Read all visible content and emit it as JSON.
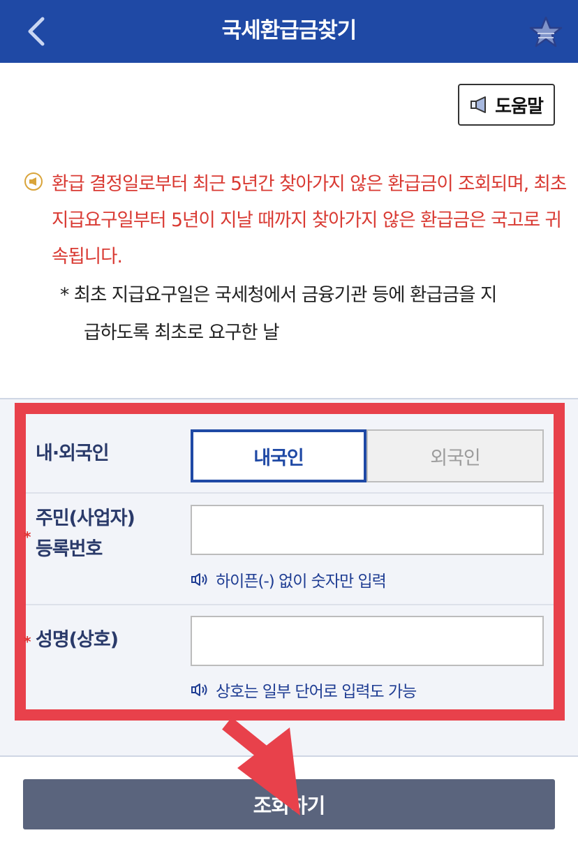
{
  "header": {
    "title": "국세환급금찾기"
  },
  "help": {
    "label": "도움말"
  },
  "notice": {
    "text": "환급 결정일로부터 최근 5년간 찾아가지 않은 환급금이 조회되며, 최초 지급요구일부터 5년이 지날 때까지 찾아가지 않은 환급금은 국고로 귀속됩니다.",
    "footnote_line1": "* 최초 지급요구일은 국세청에서 금융기관 등에 환급금을 지",
    "footnote_line2": "급하도록 최초로 요구한 날"
  },
  "form": {
    "nationality": {
      "label": "내·외국인",
      "options": [
        "내국인",
        "외국인"
      ],
      "selected": "내국인"
    },
    "reg_number": {
      "label_line1": "주민(사업자)",
      "label_line2": "등록번호",
      "required_mark": "*",
      "value": "",
      "hint": "하이픈(-) 없이 숫자만 입력"
    },
    "name": {
      "label": "성명(상호)",
      "required_mark": "*",
      "value": "",
      "hint": "상호는 일부 단어로 입력도 가능"
    }
  },
  "submit": {
    "label": "조회하기"
  },
  "colors": {
    "header": "#1f49a5",
    "notice_text": "#d93a33",
    "highlight": "#e8414b",
    "button": "#5a647d"
  }
}
